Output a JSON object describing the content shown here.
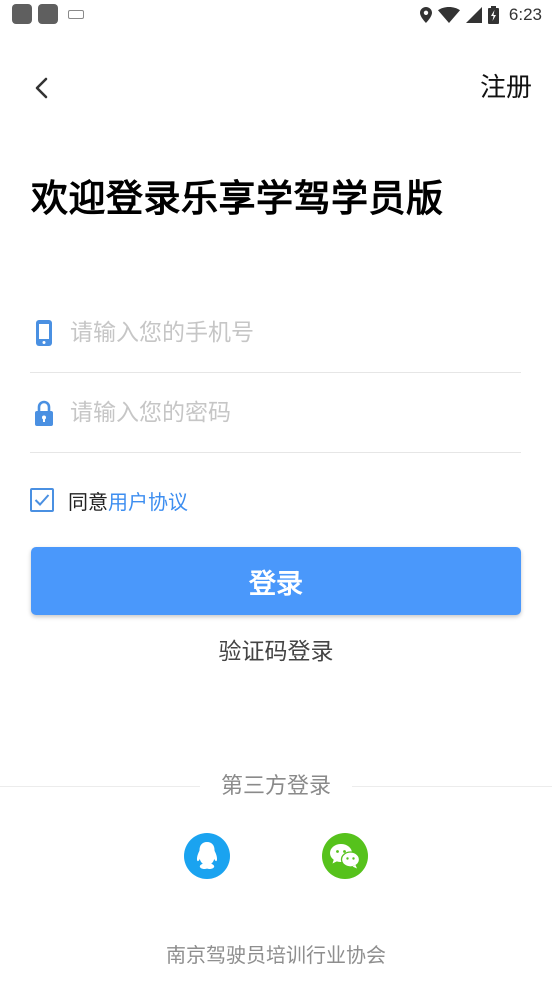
{
  "status_bar": {
    "time": "6:23",
    "icons": [
      "app-icon",
      "app-icon",
      "keyboard-icon",
      "location-icon",
      "wifi-icon",
      "signal-icon",
      "battery-icon"
    ]
  },
  "nav": {
    "back_icon": "chevron-left-icon",
    "register_label": "注册"
  },
  "title": "欢迎登录乐享学驾学员版",
  "form": {
    "phone_placeholder": "请输入您的手机号",
    "phone_icon": "phone-icon",
    "password_placeholder": "请输入您的密码",
    "password_icon": "lock-icon",
    "agree_prefix": "同意",
    "agree_link": "用户协议",
    "agree_checked": true,
    "login_label": "登录",
    "sms_login_label": "验证码登录"
  },
  "third_party": {
    "label": "第三方登录",
    "providers": [
      {
        "name": "qq-icon",
        "color": "#1aa3f0"
      },
      {
        "name": "wechat-icon",
        "color": "#56c21c"
      }
    ]
  },
  "footer": "南京驾驶员培训行业协会",
  "colors": {
    "accent": "#4a98fb",
    "link": "#3d8ef0",
    "icon_blue": "#4a90e2"
  }
}
